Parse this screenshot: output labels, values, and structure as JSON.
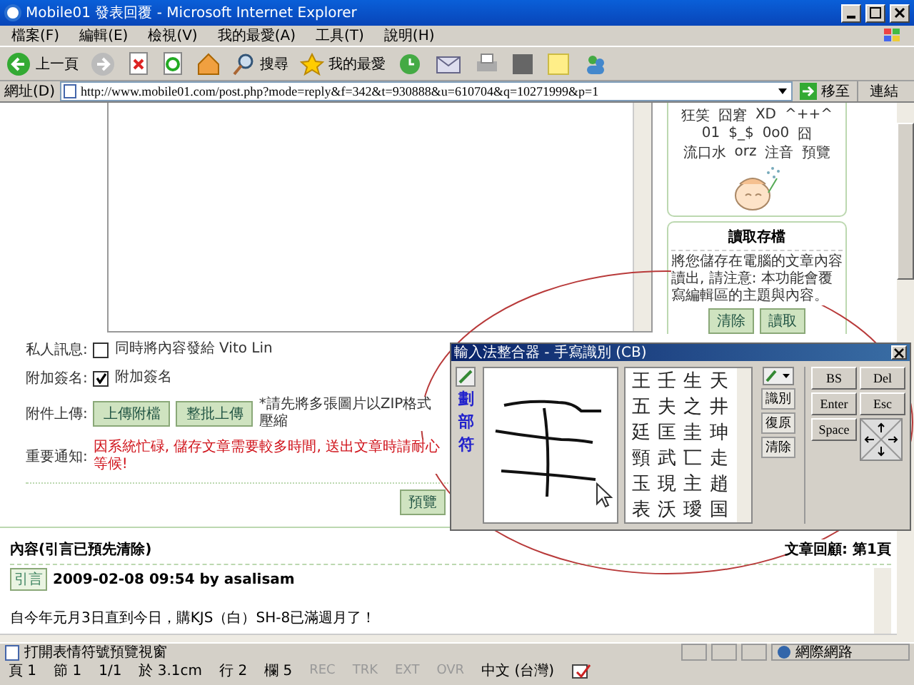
{
  "window": {
    "title": "Mobile01 發表回覆 - Microsoft Internet Explorer"
  },
  "menu": [
    "檔案(F)",
    "編輯(E)",
    "檢視(V)",
    "我的最愛(A)",
    "工具(T)",
    "說明(H)"
  ],
  "toolbar": {
    "back": "上一頁",
    "search": "搜尋",
    "favorites": "我的最愛"
  },
  "address_bar": {
    "label": "網址(D)",
    "url": "http://www.mobile01.com/post.php?mode=reply&f=342&t=930888&u=610704&q=10271999&p=1",
    "go": "移至",
    "links": "連結"
  },
  "emoticons": [
    [
      "狂笑",
      "囧窘",
      "XD",
      "^++^"
    ],
    [
      "01",
      "$_$",
      "0o0",
      "囧"
    ],
    [
      "流口水",
      "orz",
      "注音",
      "預覽"
    ]
  ],
  "draft_card": {
    "title": "讀取存檔",
    "text": "將您儲存在電腦的文章內容讀出, 請注意: 本功能會覆寫編輯區的主題與內容。",
    "buttons": [
      "清除",
      "讀取"
    ]
  },
  "form": {
    "private_message": {
      "label": "私人訊息:",
      "option": "同時將內容發給 Vito Lin",
      "checked": false
    },
    "signature": {
      "label": "附加簽名:",
      "option": "附加簽名",
      "checked": true
    },
    "attachment": {
      "label": "附件上傳:",
      "buttons": [
        "上傳附檔",
        "整批上傳"
      ],
      "note": "*請先將多張圖片以ZIP格式壓縮"
    },
    "notice": {
      "label": "重要通知:",
      "text": "因系統忙碌, 儲存文章需要較多時間, 送出文章時請耐心等候!"
    },
    "preview_button": "預覽"
  },
  "review": {
    "title": "內容(引言已預先清除)",
    "page": "文章回顧: 第1頁",
    "quote_tag": "引言",
    "meta": "2009-02-08 09:54 by asalisam",
    "body": "自今年元月3日直到今日，購KJS（白）SH-8已滿週月了！"
  },
  "status_bar": {
    "text": "打開表情符號預覽視窗",
    "zone": "網際網路"
  },
  "word_status": {
    "items": [
      "頁 1",
      "節 1",
      "1/1",
      "於 3.1cm",
      "行 2",
      "欄 5"
    ],
    "modes": [
      {
        "label": "REC",
        "on": false
      },
      {
        "label": "TRK",
        "on": false
      },
      {
        "label": "EXT",
        "on": false
      },
      {
        "label": "OVR",
        "on": false
      }
    ],
    "language": "中文 (台灣)"
  },
  "ime": {
    "title": "輸入法整合器 - 手寫識別 (CB)",
    "side": [
      "劃",
      "部",
      "符"
    ],
    "candidates": [
      "王",
      "壬",
      "生",
      "天",
      "五",
      "夫",
      "之",
      "井",
      "廷",
      "匡",
      "圭",
      "珅",
      "頸",
      "武",
      "匸",
      "走",
      "玉",
      "現",
      "主",
      "趙",
      "表",
      "沃",
      "璦",
      "国"
    ],
    "actions": [
      "識別",
      "復原",
      "清除"
    ],
    "keys": [
      "BS",
      "Del",
      "Enter",
      "Esc",
      "Space"
    ]
  }
}
